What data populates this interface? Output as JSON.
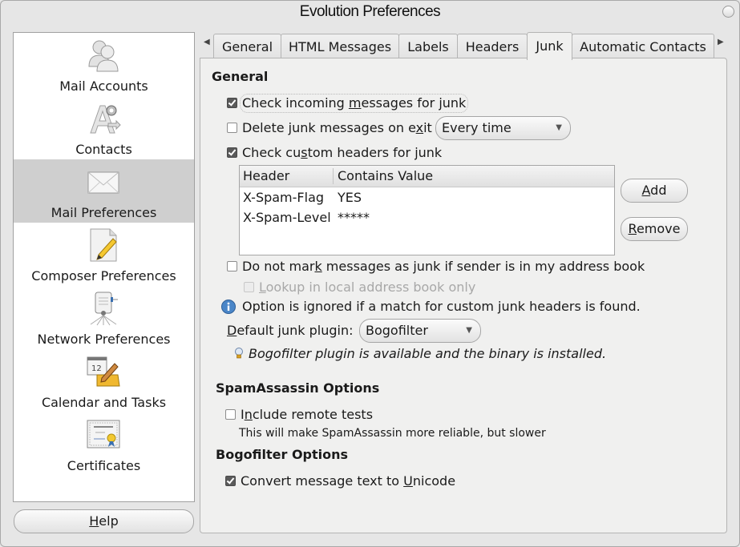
{
  "window": {
    "title": "Evolution Preferences"
  },
  "sidebar": {
    "items": [
      {
        "label": "Mail Accounts",
        "icon": "accounts-icon",
        "selected": false
      },
      {
        "label": "Contacts",
        "icon": "contacts-icon",
        "selected": false
      },
      {
        "label": "Mail Preferences",
        "icon": "envelope-icon",
        "selected": true
      },
      {
        "label": "Composer Preferences",
        "icon": "composer-icon",
        "selected": false
      },
      {
        "label": "Network Preferences",
        "icon": "network-icon",
        "selected": false
      },
      {
        "label": "Calendar and Tasks",
        "icon": "calendar-icon",
        "selected": false
      },
      {
        "label": "Certificates",
        "icon": "certificate-icon",
        "selected": false
      }
    ],
    "help_label_mnemonic": "H",
    "help_label_rest": "elp"
  },
  "tabs": {
    "items": [
      "General",
      "HTML Messages",
      "Labels",
      "Headers",
      "Junk",
      "Automatic Contacts"
    ],
    "active": "Junk"
  },
  "junk": {
    "general_title": "General",
    "check_incoming": {
      "pre": "Check incoming ",
      "mn": "m",
      "post": "essages for junk",
      "checked": true
    },
    "delete_on_exit": {
      "pre": "Delete junk messages on e",
      "mn": "x",
      "post": "it",
      "checked": false
    },
    "delete_when": {
      "value": "Every time"
    },
    "check_custom": {
      "pre": "Check cu",
      "mn": "s",
      "post": "tom headers for junk",
      "checked": true
    },
    "headers_table": {
      "columns": [
        "Header",
        "Contains Value"
      ],
      "rows": [
        {
          "header": "X-Spam-Flag",
          "value": "YES"
        },
        {
          "header": "X-Spam-Level",
          "value": "*****"
        }
      ]
    },
    "add_button": {
      "mn": "A",
      "rest": "dd"
    },
    "remove_button": {
      "mn": "R",
      "rest": "emove"
    },
    "do_not_mark": {
      "pre": "Do not mar",
      "mn": "k",
      "post": " messages as junk if sender is in my address book",
      "checked": false
    },
    "lookup_local": {
      "mn": "L",
      "post": "ookup in local address book only",
      "checked": false,
      "disabled": true
    },
    "info_text": "Option is ignored if a match for custom junk headers is found.",
    "default_plugin_label": {
      "mn": "D",
      "post": "efault junk plugin:"
    },
    "default_plugin_value": "Bogofilter",
    "plugin_status": "Bogofilter plugin is available and the binary is installed.",
    "spamassassin_title": "SpamAssassin Options",
    "include_remote": {
      "pre": "I",
      "mn": "n",
      "post": "clude remote tests",
      "checked": false
    },
    "include_remote_hint": "This will make SpamAssassin more reliable, but slower",
    "bogofilter_title": "Bogofilter Options",
    "convert_unicode": {
      "pre": "Convert message text to ",
      "mn": "U",
      "post": "nicode",
      "checked": true
    }
  }
}
